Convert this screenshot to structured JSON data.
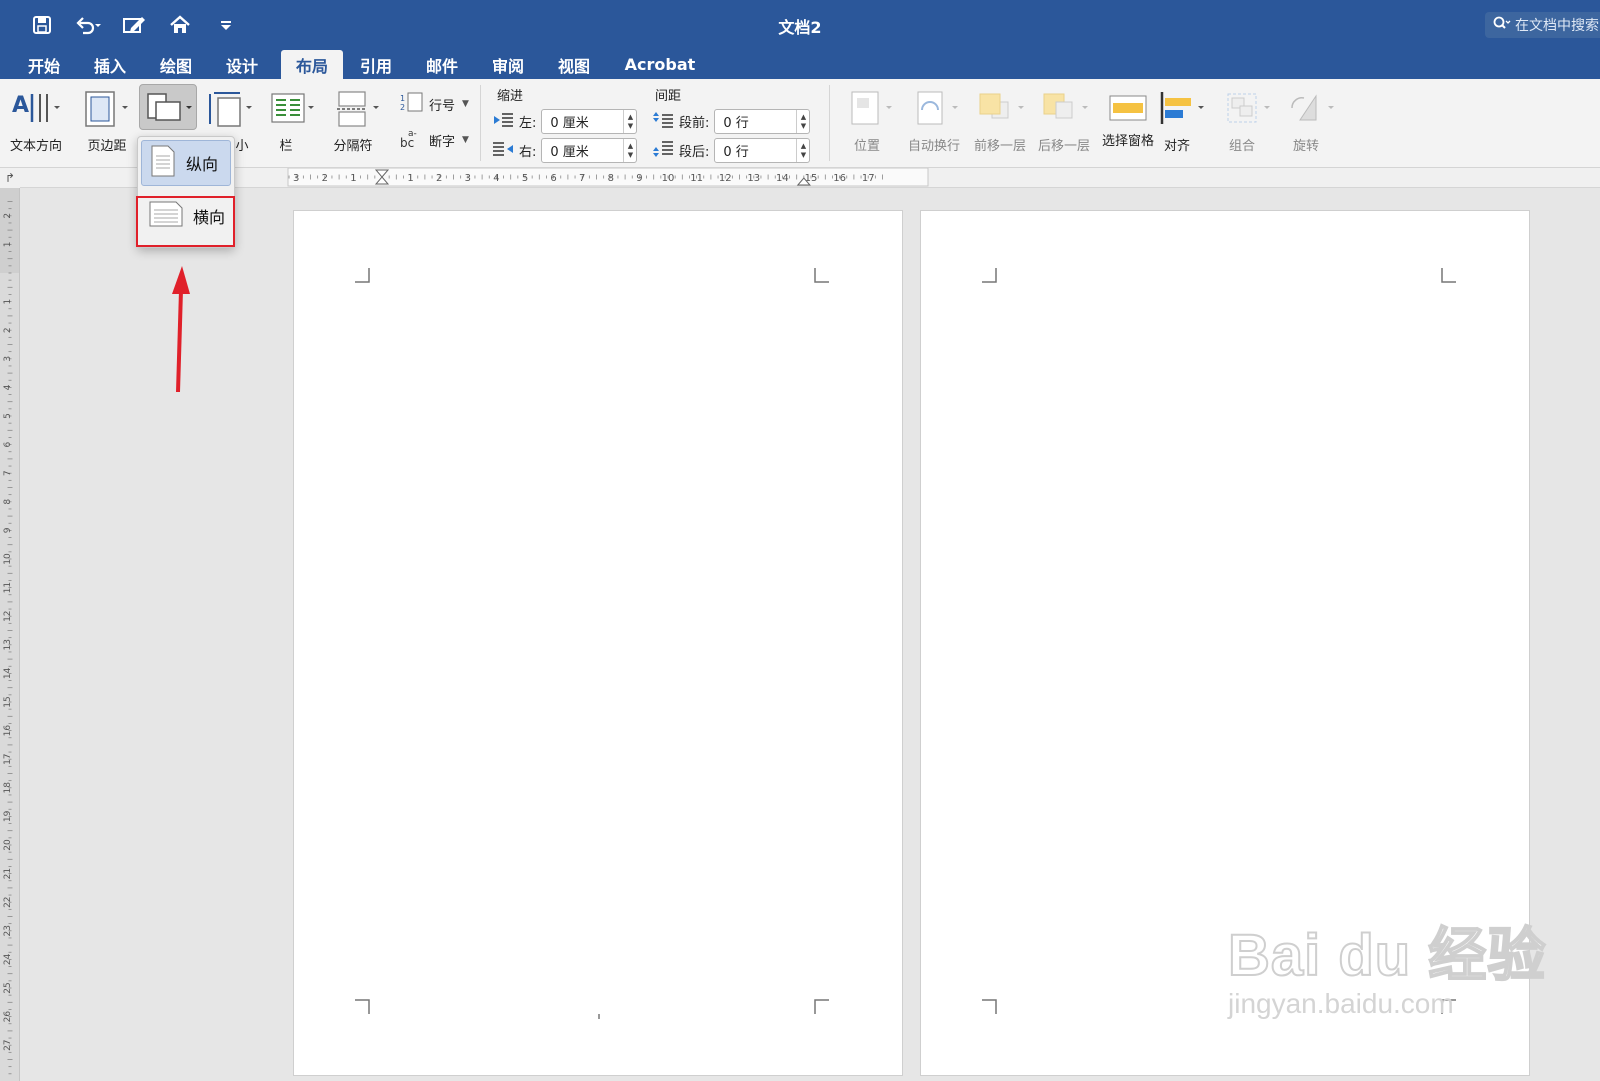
{
  "window": {
    "title": "文档2",
    "search_placeholder": "在文档中搜索"
  },
  "tabs": [
    "开始",
    "插入",
    "绘图",
    "设计",
    "布局",
    "引用",
    "邮件",
    "审阅",
    "视图",
    "Acrobat"
  ],
  "active_tab": "布局",
  "ribbon": {
    "text_direction": "文本方向",
    "margins": "页边距",
    "size": "小",
    "columns": "栏",
    "breaks": "分隔符",
    "line_numbers": "行号",
    "hyphenation": "断字",
    "indent_label": "缩进",
    "spacing_label": "间距",
    "left_label": "左:",
    "right_label": "右:",
    "left_value": "0 厘米",
    "right_value": "0 厘米",
    "before_label": "段前:",
    "after_label": "段后:",
    "before_value": "0 行",
    "after_value": "0 行",
    "position": "位置",
    "wrap_text": "自动换行",
    "bring_forward": "前移一层",
    "send_backward": "后移一层",
    "selection_pane": "选择窗格",
    "align": "对齐",
    "group": "组合",
    "rotate": "旋转"
  },
  "orientation_menu": {
    "portrait": "纵向",
    "landscape": "横向"
  },
  "ruler": {
    "h_labels": [
      "3",
      "2",
      "1",
      "1",
      "2",
      "3",
      "4",
      "5",
      "6",
      "7",
      "8",
      "9",
      "10",
      "11",
      "12",
      "13",
      "14",
      "15",
      "16",
      "17"
    ],
    "v_labels": [
      "2",
      "1",
      "1",
      "2",
      "3",
      "4",
      "5",
      "6",
      "7",
      "8",
      "9",
      "10",
      "11",
      "12",
      "13",
      "14",
      "15",
      "16",
      "17",
      "18",
      "19",
      "20",
      "21",
      "22",
      "23",
      "24",
      "25",
      "26",
      "27"
    ]
  },
  "watermark": {
    "logo": "Bai du 经验",
    "url": "jingyan.baidu.com"
  },
  "colors": {
    "titlebar": "#2b579a",
    "highlight_box": "#e0202a",
    "arrow": "#e0202a"
  }
}
